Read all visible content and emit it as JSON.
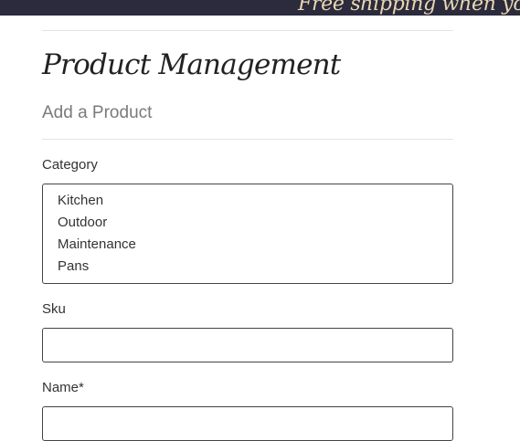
{
  "banner": {
    "text": "Free shipping when you spe"
  },
  "page": {
    "title": "Product Management",
    "subtitle": "Add a Product"
  },
  "form": {
    "category": {
      "label": "Category",
      "options": [
        "Kitchen",
        "Outdoor",
        "Maintenance",
        "Pans",
        ""
      ]
    },
    "sku": {
      "label": "Sku",
      "value": ""
    },
    "name": {
      "label": "Name*",
      "value": ""
    }
  }
}
